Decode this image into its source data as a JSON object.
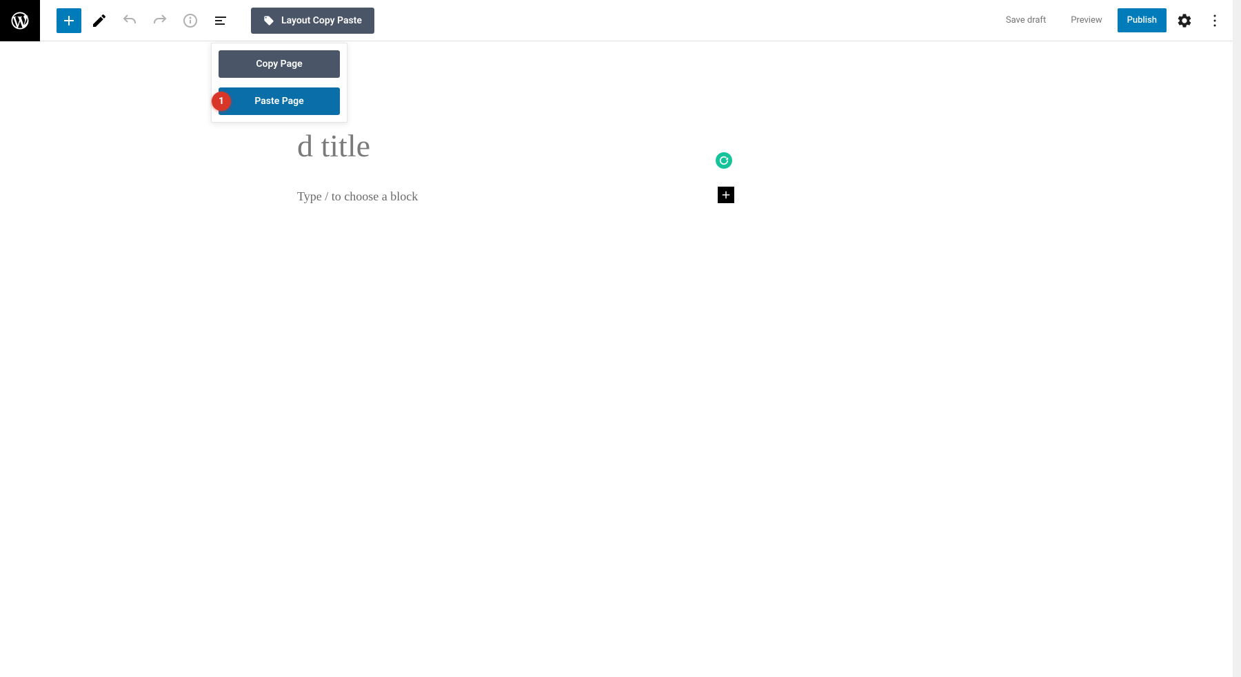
{
  "toolbar": {
    "layout_button_label": "Layout Copy Paste",
    "save_draft_label": "Save draft",
    "preview_label": "Preview",
    "publish_label": "Publish"
  },
  "dropdown": {
    "copy_label": "Copy Page",
    "paste_label": "Paste Page",
    "badge_number": "1"
  },
  "editor": {
    "title_placeholder": "d title",
    "block_placeholder": "Type / to choose a block"
  }
}
